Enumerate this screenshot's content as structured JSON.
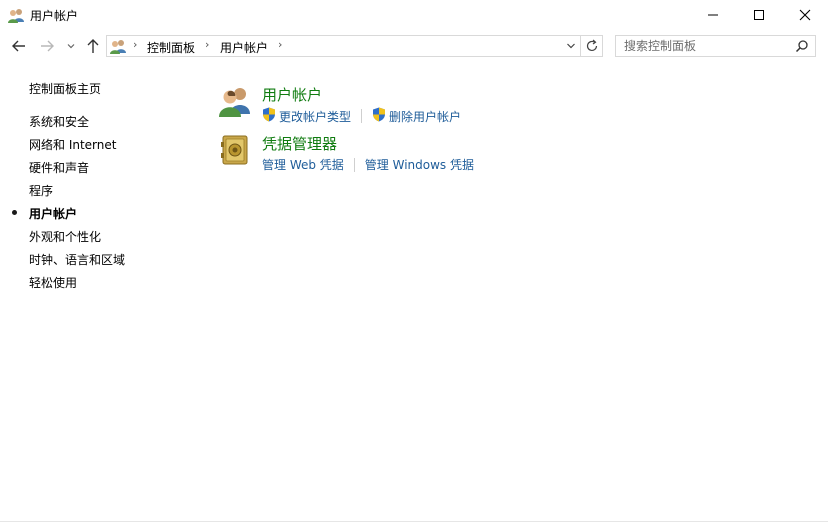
{
  "window": {
    "title": "用户帐户"
  },
  "nav": {
    "breadcrumb": [
      "控制面板",
      "用户帐户"
    ]
  },
  "search": {
    "placeholder": "搜索控制面板"
  },
  "sidebar": {
    "items": [
      {
        "label": "控制面板主页",
        "active": false
      },
      {
        "label": "系统和安全",
        "active": false
      },
      {
        "label": "网络和 Internet",
        "active": false
      },
      {
        "label": "硬件和声音",
        "active": false
      },
      {
        "label": "程序",
        "active": false
      },
      {
        "label": "用户帐户",
        "active": true
      },
      {
        "label": "外观和个性化",
        "active": false
      },
      {
        "label": "时钟、语言和区域",
        "active": false
      },
      {
        "label": "轻松使用",
        "active": false
      }
    ]
  },
  "main": {
    "categories": [
      {
        "title": "用户帐户",
        "icon": "users-icon",
        "links": [
          {
            "label": "更改帐户类型",
            "icon": "uac-shield-icon"
          },
          {
            "label": "删除用户帐户",
            "icon": "uac-shield-icon"
          }
        ]
      },
      {
        "title": "凭据管理器",
        "icon": "credential-vault-icon",
        "links": [
          {
            "label": "管理 Web 凭据"
          },
          {
            "label": "管理 Windows 凭据"
          }
        ]
      }
    ]
  },
  "colors": {
    "category_title": "#107c10",
    "link": "#1e5c99"
  }
}
